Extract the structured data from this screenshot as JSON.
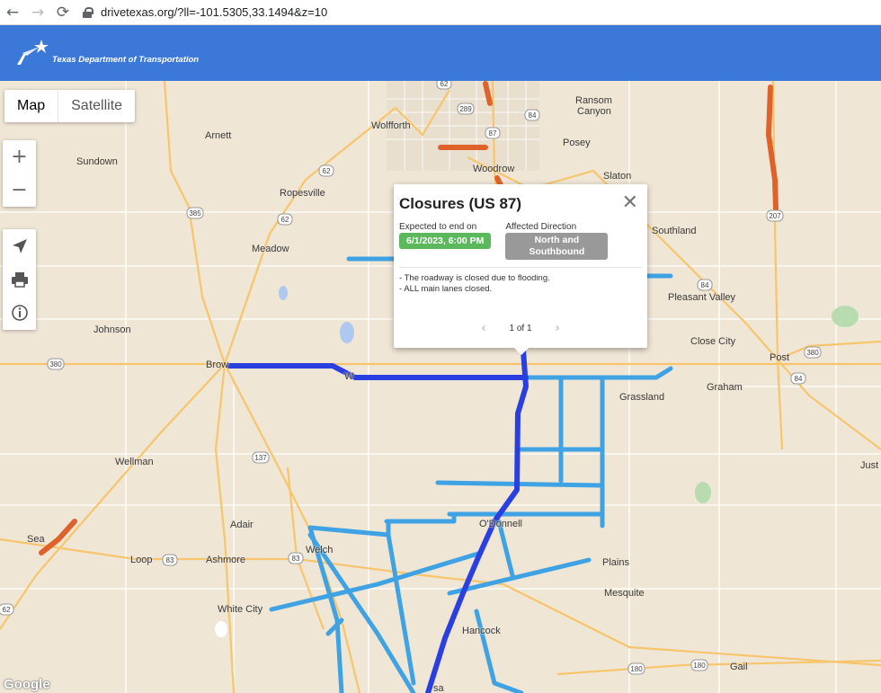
{
  "browser": {
    "back_icon": "arrow-left-icon",
    "forward_icon": "arrow-right-icon",
    "reload_icon": "reload-icon",
    "url": "drivetexas.org/?ll=-101.5305,33.1494&z=10"
  },
  "header": {
    "agency": "Texas Department of Transportation"
  },
  "map_controls": {
    "map_label": "Map",
    "satellite_label": "Satellite",
    "zoom_in": "+",
    "zoom_out": "−"
  },
  "towns": [
    {
      "name": "Ransom"
    },
    {
      "name": "Canyon"
    },
    {
      "name": "Wolfforth"
    },
    {
      "name": "Arnett"
    },
    {
      "name": "Posey"
    },
    {
      "name": "Sundown"
    },
    {
      "name": "Woodrow"
    },
    {
      "name": "Slaton"
    },
    {
      "name": "Ropesville"
    },
    {
      "name": "Southland"
    },
    {
      "name": "Meadow"
    },
    {
      "name": "Pleasant Valley"
    },
    {
      "name": "Johnson"
    },
    {
      "name": "Close City"
    },
    {
      "name": "Post"
    },
    {
      "name": "Brow"
    },
    {
      "name": "W"
    },
    {
      "name": "Grassland"
    },
    {
      "name": "Graham"
    },
    {
      "name": "Just"
    },
    {
      "name": "Wellman"
    },
    {
      "name": "O'Donnell"
    },
    {
      "name": "Adair"
    },
    {
      "name": "Sea"
    },
    {
      "name": "Loop"
    },
    {
      "name": "Ashmore"
    },
    {
      "name": "Welch"
    },
    {
      "name": "Plains"
    },
    {
      "name": "Mesquite"
    },
    {
      "name": "White City"
    },
    {
      "name": "Hancock"
    },
    {
      "name": "Gail"
    },
    {
      "name": "sa"
    }
  ],
  "shields": [
    "62",
    "289",
    "84",
    "87",
    "62",
    "385",
    "62",
    "207",
    "84",
    "380",
    "84",
    "380",
    "137",
    "83",
    "83",
    "180",
    "180",
    "62"
  ],
  "popup": {
    "title": "Closures (US 87)",
    "end_label": "Expected to end on",
    "end_value": "6/1/2023, 6:00 PM",
    "direction_label": "Affected Direction",
    "direction_value": "North and Southbound",
    "description_line1": "- The roadway is closed due to flooding.",
    "description_line2": "- ALL main lanes closed.",
    "pager": "1 of 1",
    "close_icon": "close-icon"
  },
  "colors": {
    "header": "#3c78d8",
    "closure_orange": "#e0622b",
    "closure_light_blue": "#3fa3e3",
    "closure_dark_blue": "#2a3fe0",
    "end_badge": "#5cb85c",
    "direction_badge": "#999999"
  },
  "attribution": "Google"
}
